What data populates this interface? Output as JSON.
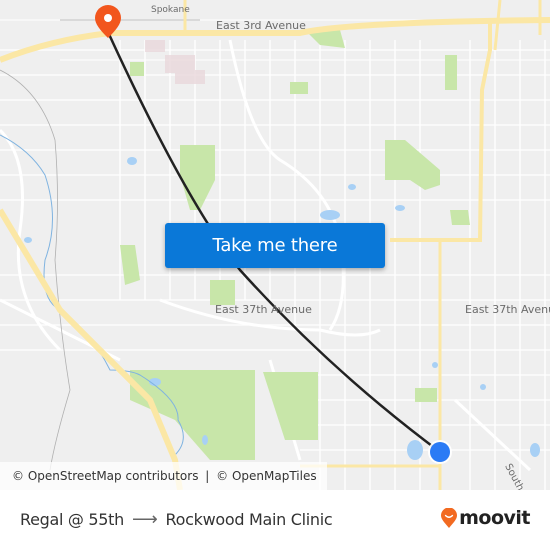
{
  "map": {
    "labels": {
      "spokane": "Spokane",
      "east_3rd": "East 3rd Avenue",
      "east_37th_left": "East 37th Avenue",
      "east_37th_right": "East 37th Avenue",
      "south_pa": "South Pa"
    },
    "colors": {
      "land": "#efefef",
      "street": "#ffffff",
      "highway": "#fbe7a5",
      "park": "#c8e6a9",
      "water": "#a8d0f5",
      "river": "#7fb3e0",
      "route_line": "#222222",
      "origin_marker": "#2b7bf5",
      "destination_marker": "#f2561d"
    },
    "origin": {
      "name": "Regal @ 55th",
      "icon": "origin-dot-icon"
    },
    "destination": {
      "name": "Rockwood Main Clinic",
      "icon": "map-pin-icon"
    }
  },
  "cta": {
    "label": "Take me there"
  },
  "attribution": {
    "osm": "© OpenStreetMap contributors",
    "separator": "|",
    "omt": "© OpenMapTiles"
  },
  "footer": {
    "from": "Regal @ 55th",
    "arrow": "⟶",
    "to": "Rockwood Main Clinic",
    "brand": "moovit",
    "brand_color": "#f26a21"
  }
}
